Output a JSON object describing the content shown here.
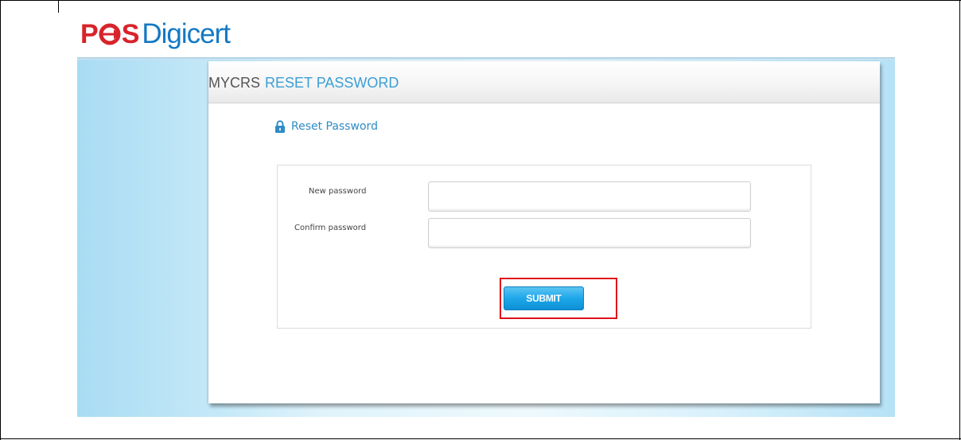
{
  "logo": {
    "brand_pos": "POS",
    "brand_digicert": "Digicert"
  },
  "panel": {
    "app_name": "MYCRS",
    "page_title": "RESET PASSWORD",
    "section_title": "Reset Password",
    "section_icon": "lock-icon"
  },
  "form": {
    "new_password_label": "New password",
    "new_password_value": "",
    "confirm_password_label": "Confirm password",
    "confirm_password_value": "",
    "submit_label": "SUBMIT"
  },
  "colors": {
    "brand_red": "#d8232a",
    "brand_blue": "#1479c4",
    "accent_blue": "#3a9fd6",
    "button_blue": "#1ea7ea",
    "highlight_red": "#e0101a"
  }
}
